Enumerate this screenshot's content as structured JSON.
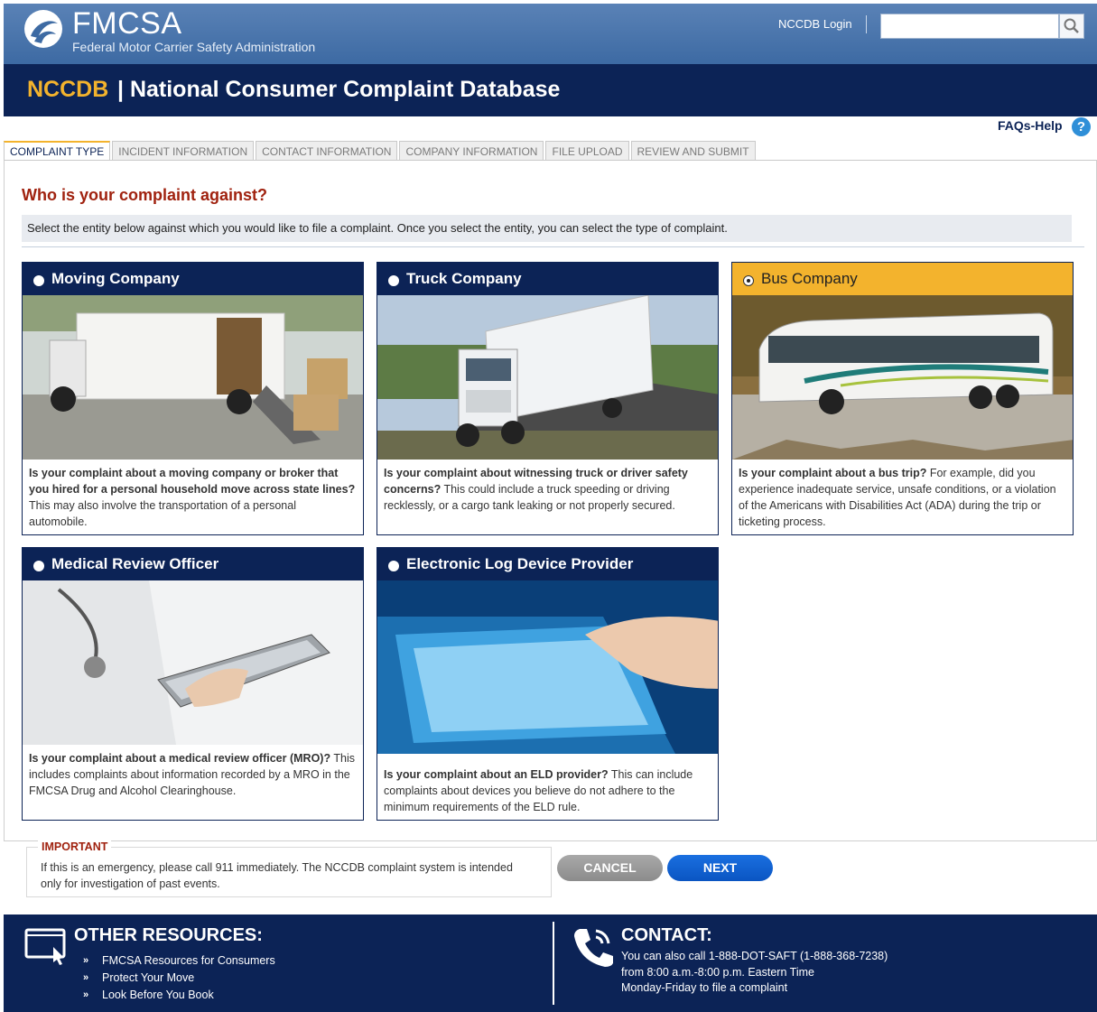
{
  "header": {
    "logo_title": "FMCSA",
    "logo_subtitle": "Federal Motor Carrier Safety Administration",
    "login_link": "NCCDB Login",
    "search_placeholder": ""
  },
  "title": {
    "acronym": "NCCDB",
    "rest": "| National Consumer Complaint Database"
  },
  "faq": {
    "label": "FAQs-Help",
    "icon": "help-icon"
  },
  "tabs": [
    {
      "label": "COMPLAINT TYPE",
      "active": true
    },
    {
      "label": "INCIDENT INFORMATION"
    },
    {
      "label": "CONTACT INFORMATION"
    },
    {
      "label": "COMPANY INFORMATION"
    },
    {
      "label": "FILE UPLOAD"
    },
    {
      "label": "REVIEW AND SUBMIT"
    }
  ],
  "main": {
    "question": "Who is your complaint against?",
    "instruction": "Select the entity below against which you would like to file a complaint. Once you select the entity, you can select the type of complaint."
  },
  "cards": [
    {
      "title": "Moving Company",
      "bold": "Is your complaint about a moving company or broker that you hired for a personal household move across state lines?",
      "text": " This may also involve the transportation of a personal automobile."
    },
    {
      "title": "Truck Company",
      "bold": "Is your complaint about witnessing truck or driver safety concerns?",
      "text": " This could include a truck speeding or driving recklessly, or a cargo tank leaking or not properly secured."
    },
    {
      "title": "Bus Company",
      "selected": true,
      "bold": "Is your complaint about a bus trip?",
      "text": " For example, did you experience inadequate service, unsafe conditions, or a violation of the Americans with Disabilities Act (ADA) during the trip or ticketing process."
    },
    {
      "title": "Medical Review Officer",
      "bold": "Is your complaint about a medical review officer (MRO)?",
      "text": " This includes complaints about information recorded by a MRO in the FMCSA Drug and Alcohol Clearinghouse."
    },
    {
      "title": "Electronic Log Device Provider",
      "bold": "Is your complaint about an ELD provider?",
      "text": " This can include complaints about devices you believe do not adhere to the minimum requirements of the ELD rule."
    }
  ],
  "important": {
    "label": "IMPORTANT",
    "text": "If this is an emergency, please call 911 immediately. The NCCDB complaint system is intended only for investigation of past events."
  },
  "buttons": {
    "cancel": "CANCEL",
    "next": "NEXT"
  },
  "footer": {
    "resources_title": "OTHER RESOURCES:",
    "resources": [
      "FMCSA Resources for Consumers",
      "Protect Your Move",
      "Look Before You Book"
    ],
    "contact_title": "CONTACT:",
    "contact_lines": [
      "You can also call 1-888-DOT-SAFT (1-888-368-7238)",
      "from 8:00 a.m.-8:00 p.m. Eastern Time",
      "Monday-Friday to file a complaint"
    ]
  },
  "colors": {
    "navy": "#0c2356",
    "gold": "#f3b32d",
    "red_heading": "#a0220f",
    "next_blue": "#0a55c2"
  }
}
